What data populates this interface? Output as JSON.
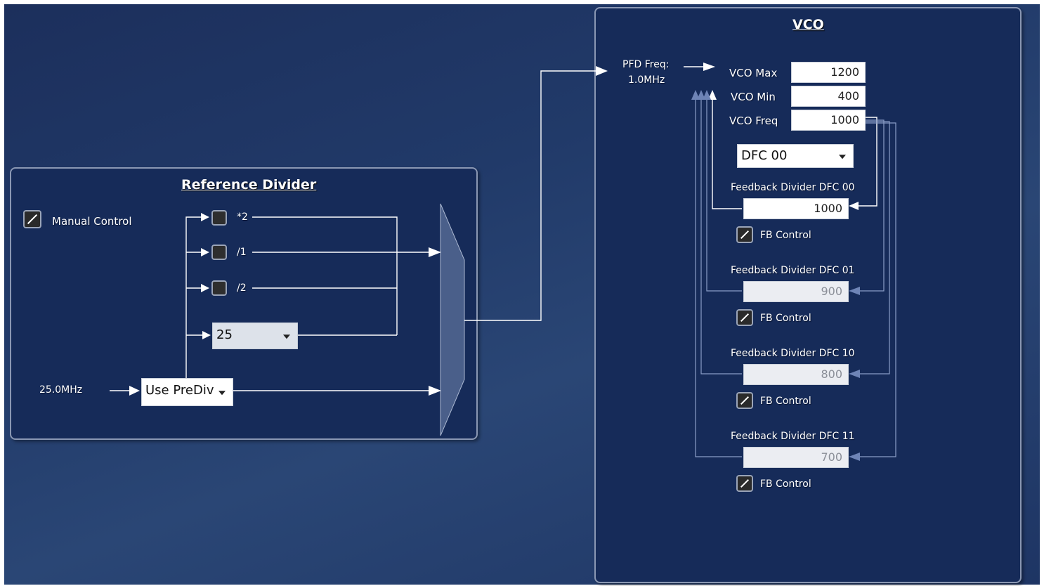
{
  "reference_divider": {
    "title": "Reference Divider",
    "manual_control_label": "Manual Control",
    "input_freq": "25.0MHz",
    "prediv_select": "Use PreDiv",
    "options": [
      "*2",
      "/1",
      "/2"
    ],
    "divider_select": "25"
  },
  "vco": {
    "title": "VCO",
    "pfd_label": "PFD Freq:",
    "pfd_value": "1.0MHz",
    "vco_max_label": "VCO Max",
    "vco_max": "1200",
    "vco_min_label": "VCO Min",
    "vco_min": "400",
    "vco_freq_label": "VCO Freq",
    "vco_freq": "1000",
    "dfc_select": "DFC 00",
    "feedback": [
      {
        "label": "Feedback Divider DFC 00",
        "value": "1000",
        "control": "FB Control"
      },
      {
        "label": "Feedback Divider DFC 01",
        "value": "900",
        "control": "FB Control"
      },
      {
        "label": "Feedback Divider DFC 10",
        "value": "800",
        "control": "FB Control"
      },
      {
        "label": "Feedback Divider DFC 11",
        "value": "700",
        "control": "FB Control"
      }
    ]
  },
  "colors": {
    "background": "#213a69",
    "panel": "#162b59",
    "wire": "#ffffff",
    "wire_inactive": "#8a9dc7",
    "mux": "#4a5f8a"
  }
}
